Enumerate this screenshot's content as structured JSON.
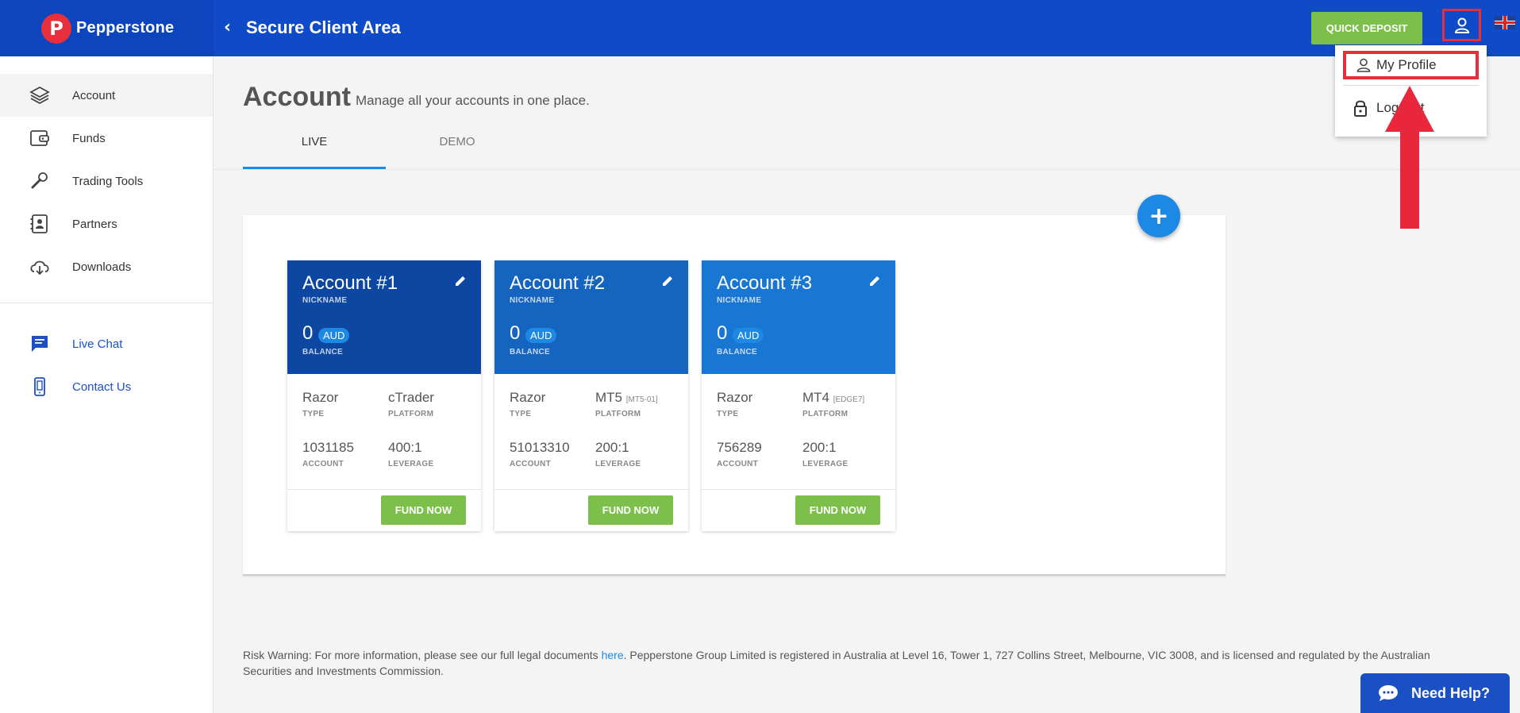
{
  "header": {
    "brand": "Pepperstone",
    "logo_letter": "P",
    "title": "Secure Client Area",
    "quick_deposit_label": "QUICK DEPOSIT"
  },
  "sidebar": {
    "items": [
      {
        "label": "Account",
        "icon": "layers-icon",
        "active": true
      },
      {
        "label": "Funds",
        "icon": "wallet-icon"
      },
      {
        "label": "Trading Tools",
        "icon": "wrench-icon"
      },
      {
        "label": "Partners",
        "icon": "contact-book-icon"
      },
      {
        "label": "Downloads",
        "icon": "cloud-download-icon"
      }
    ],
    "support": [
      {
        "label": "Live Chat",
        "icon": "chat-icon"
      },
      {
        "label": "Contact Us",
        "icon": "phone-icon"
      }
    ]
  },
  "page": {
    "title": "Account",
    "subtitle": "Manage all your accounts in one place.",
    "tabs": [
      {
        "label": "LIVE",
        "active": true
      },
      {
        "label": "DEMO"
      }
    ]
  },
  "accounts": [
    {
      "name": "Account #1",
      "nickname_label": "NICKNAME",
      "balance": "0",
      "currency": "AUD",
      "balance_label": "BALANCE",
      "type": "Razor",
      "type_label": "TYPE",
      "platform": "cTrader",
      "platform_tag": "",
      "platform_label": "PLATFORM",
      "account": "1031185",
      "account_label": "ACCOUNT",
      "leverage": "400:1",
      "leverage_label": "LEVERAGE",
      "fund_label": "FUND NOW",
      "color": "#0d47a1"
    },
    {
      "name": "Account #2",
      "nickname_label": "NICKNAME",
      "balance": "0",
      "currency": "AUD",
      "balance_label": "BALANCE",
      "type": "Razor",
      "type_label": "TYPE",
      "platform": "MT5",
      "platform_tag": "[MT5-01]",
      "platform_label": "PLATFORM",
      "account": "51013310",
      "account_label": "ACCOUNT",
      "leverage": "200:1",
      "leverage_label": "LEVERAGE",
      "fund_label": "FUND NOW",
      "color": "#1565c0"
    },
    {
      "name": "Account #3",
      "nickname_label": "NICKNAME",
      "balance": "0",
      "currency": "AUD",
      "balance_label": "BALANCE",
      "type": "Razor",
      "type_label": "TYPE",
      "platform": "MT4",
      "platform_tag": "[EDGE7]",
      "platform_label": "PLATFORM",
      "account": "756289",
      "account_label": "ACCOUNT",
      "leverage": "200:1",
      "leverage_label": "LEVERAGE",
      "fund_label": "FUND NOW",
      "color": "#1976d2"
    }
  ],
  "user_menu": {
    "profile_label": "My Profile",
    "logout_label": "Log Out"
  },
  "footer": {
    "risk_prefix": "Risk Warning: For more information, please see our full legal documents ",
    "risk_link": "here",
    "risk_suffix": ". Pepperstone Group Limited is registered in Australia at Level 16, Tower 1, 727 Collins Street, Melbourne, VIC 3008, and is licensed and regulated by the Australian Securities and Investments Commission."
  },
  "chat_widget": {
    "label": "Need Help?"
  },
  "colors": {
    "header_blue": "#0f4bc9",
    "brand_red": "#e8303d",
    "action_green": "#7cc04b",
    "accent_blue": "#1e88e5"
  }
}
